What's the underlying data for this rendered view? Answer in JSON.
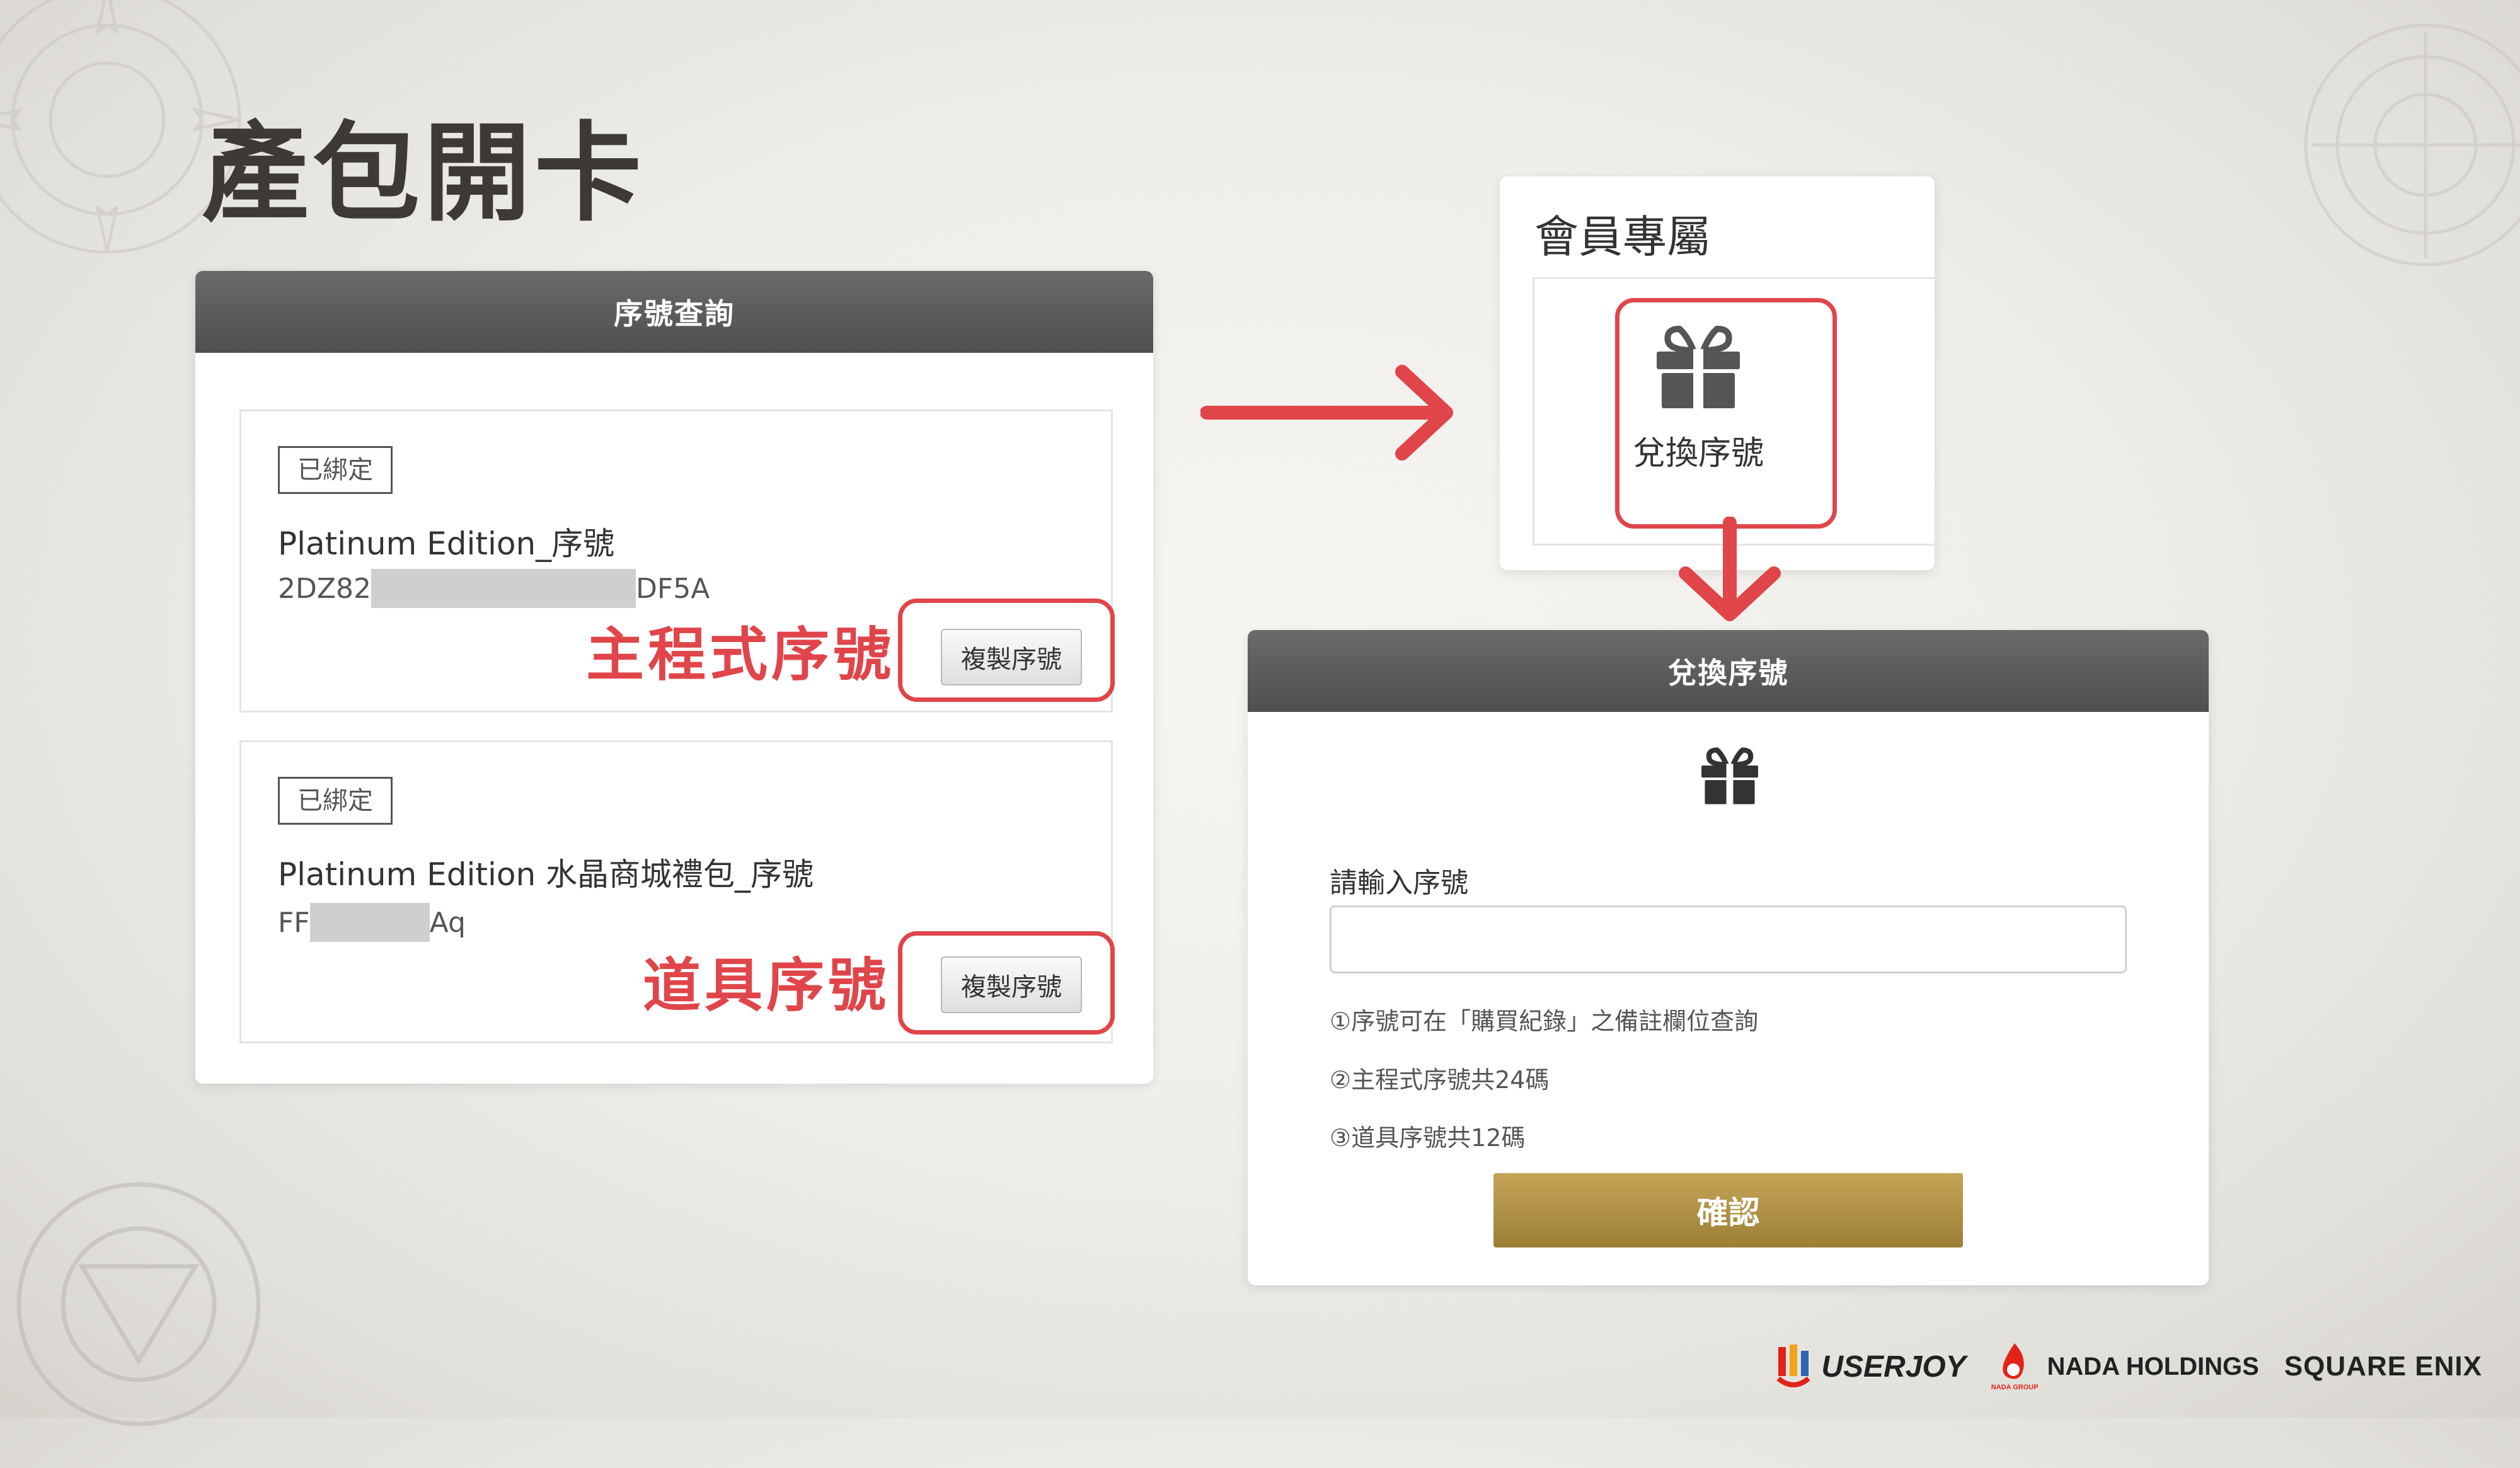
{
  "slide": {
    "title": "產包開卡"
  },
  "serial_panel": {
    "header": "序號查詢",
    "items": [
      {
        "tag": "已綁定",
        "title": "Platinum Edition_序號",
        "serial_prefix": "2DZ82",
        "serial_suffix": "DF5A",
        "copy_label": "複製序號",
        "annotation": "主程式序號"
      },
      {
        "tag": "已綁定",
        "title": "Platinum Edition 水晶商城禮包_序號",
        "serial_prefix": "FF",
        "serial_suffix": "Aq",
        "copy_label": "複製序號",
        "annotation": "道具序號"
      }
    ]
  },
  "member_panel": {
    "title": "會員專屬",
    "redeem_label": "兌換序號",
    "icon": "gift-icon"
  },
  "redeem_panel": {
    "header": "兌換序號",
    "icon": "gift-icon",
    "input_label": "請輸入序號",
    "input_value": "",
    "input_placeholder": "",
    "notes": [
      "①序號可在「購買紀錄」之備註欄位查詢",
      "②主程式序號共24碼",
      "③道具序號共12碼"
    ],
    "confirm_label": "確認"
  },
  "footer": {
    "logos": [
      "USERJOY",
      "NADA HOLDINGS",
      "SQUARE ENIX"
    ],
    "nada_sub": "NADA GROUP"
  },
  "colors": {
    "accent_red": "#e0454a",
    "header_gray": "#595959",
    "confirm_gold": "#a98a3e",
    "title_dark": "#3d3a36"
  }
}
